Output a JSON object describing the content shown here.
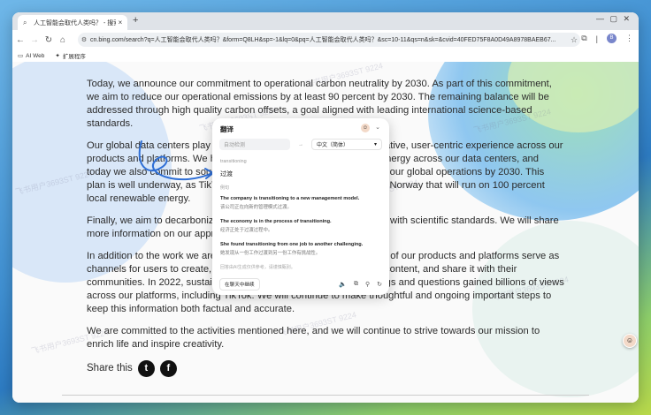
{
  "browser": {
    "tab_title": "人工智能会取代人类吗？ - 搜索",
    "tab_close": "×",
    "new_tab": "+",
    "window_controls": "— ▢ ✕",
    "url": "cn.bing.com/search?q=人工智能会取代人类吗？&form=Q8LH&sp=-1&lq=0&pq=人工智能会取代人类吗？&sc=10-11&qs=n&sk=&cvid=40FED75F8A0D49A8978BAEB67...",
    "profile_initial": "B",
    "bookmarks": [
      {
        "icon": "folder-icon",
        "label": "AI Web"
      },
      {
        "icon": "puzzle-icon",
        "label": "扩展程序"
      }
    ]
  },
  "article": {
    "p1": "Today, we announce our commitment to operational carbon neutrality by 2030. As part of this commitment, we aim to reduce our operational emissions by at least 90 percent by 2030. The remaining balance will be addressed through high quality carbon offsets, a goal aligned with leading international science-based standards.",
    "p2_before": "Our global data centers play a critical role in helping to provide a creative, user-centric experience across our products and platforms. We have begun ",
    "p2_highlight": "transitioning",
    "p2_after": " to renewable energy across our data centers, and today we also commit to source 100 percent renewable electricity for our global operations by 2030. This plan is well underway, as TikTok recently announced a data center in Norway that will run on 100 percent local renewable energy.",
    "p3": "Finally, we aim to decarbonize our operations in a manner consistent with scientific standards. We will share more information on our approach in the coming months.",
    "p4": "In addition to the work we are doing within our own operations, many of our products and platforms serve as channels for users to create, discover and share environmental and content, and share it with their communities. In 2022, sustainability and environment-related hashtags and questions gained billions of views across our platforms, including TikTok. We will continue to make thoughtful and ongoing important steps to keep this information both factual and accurate.",
    "p5": "We are committed to the activities mentioned here, and we will continue to strive towards our mission to enrich life and inspire creativity.",
    "share_label": "Share this"
  },
  "watermark": "飞书用户3693ST 9224",
  "translator": {
    "title": "翻译",
    "source_lang": "自动检测",
    "arrow": "→",
    "target_lang": "中文（简体）",
    "source_word": "transitioning",
    "translation": "过渡",
    "examples_label": "例句",
    "examples": [
      {
        "en": "The company is transitioning to a new management model.",
        "zh": "该公司正在向新的管理模式过渡。"
      },
      {
        "en": "The economy is in the process of transitioning.",
        "zh": "经济正处于过渡过程中。"
      },
      {
        "en": "She found transitioning from one job to another challenging.",
        "zh": "她发现从一份工作过渡到另一份工作有挑战性。"
      }
    ],
    "note": "回答由AI生成仅供参考，请谨慎甄别。",
    "continue_label": "在聊天中继续"
  }
}
